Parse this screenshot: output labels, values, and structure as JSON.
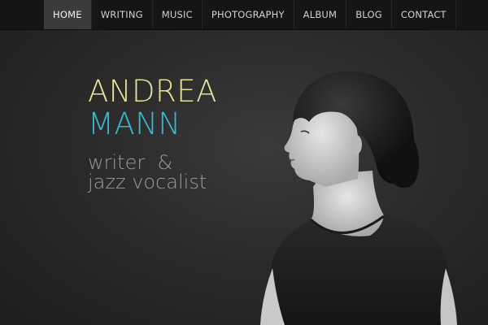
{
  "nav": {
    "items": [
      {
        "label": "HOME",
        "active": true
      },
      {
        "label": "WRITING",
        "active": false
      },
      {
        "label": "MUSIC",
        "active": false
      },
      {
        "label": "PHOTOGRAPHY",
        "active": false
      },
      {
        "label": "ALBUM",
        "active": false
      },
      {
        "label": "BLOG",
        "active": false
      },
      {
        "label": "CONTACT",
        "active": false
      }
    ]
  },
  "hero": {
    "first_name": "ANDREA",
    "last_name": "MANN",
    "tagline_line1": "writer  &",
    "tagline_line2": "jazz vocalist"
  },
  "colors": {
    "first_name": "#e5e39a",
    "last_name": "#3cb7d0",
    "tagline": "#9a9a9a",
    "nav_bg": "#151515",
    "nav_active_bg": "#3b3b3b"
  }
}
